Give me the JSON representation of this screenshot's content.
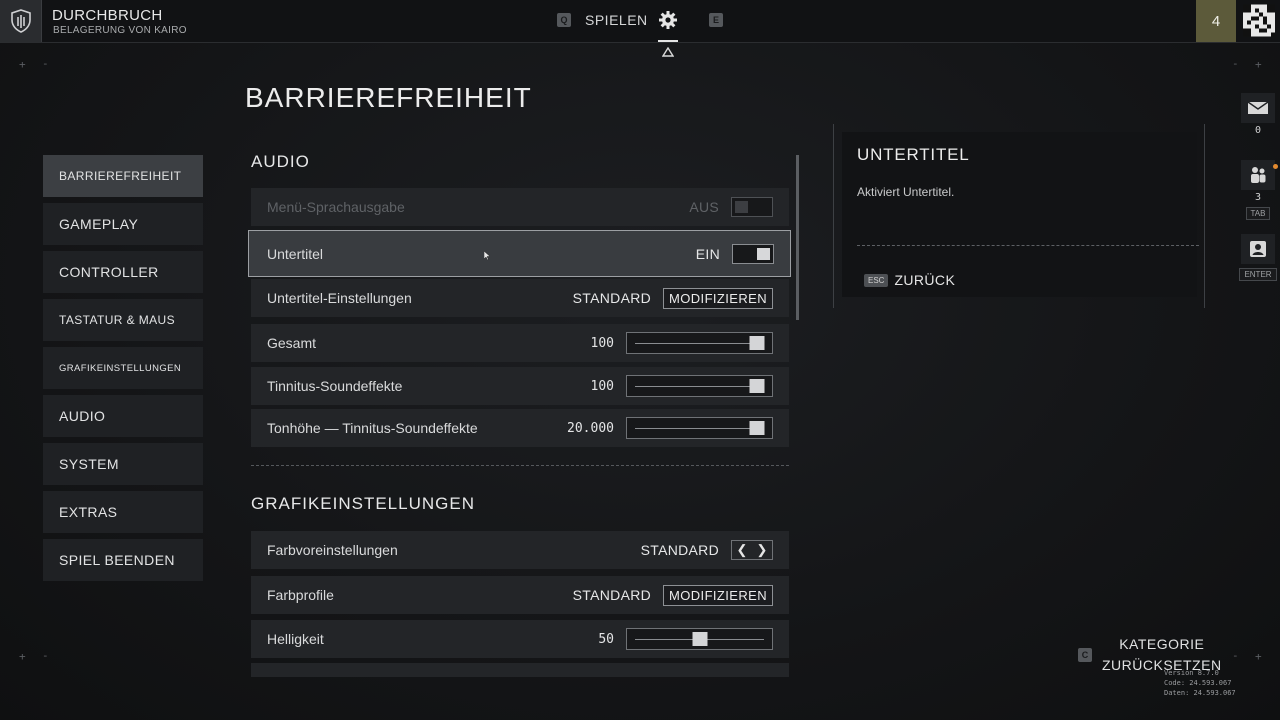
{
  "topbar": {
    "mode_title": "DURCHBRUCH",
    "mode_subtitle": "BELAGERUNG VON KAIRO",
    "nav_left_key": "Q",
    "nav_play": "SPIELEN",
    "nav_right_key": "E",
    "level": "4",
    "icons": {
      "mode": "shield-icon",
      "settings": "gear-icon",
      "profile": "qr-code-icon"
    }
  },
  "page": {
    "title": "BARRIEREFREIHEIT"
  },
  "menu": {
    "items": [
      {
        "label": "BARRIEREFREIHEIT",
        "active": true
      },
      {
        "label": "GAMEPLAY"
      },
      {
        "label": "CONTROLLER"
      },
      {
        "label": "TASTATUR & MAUS"
      },
      {
        "label": "GRAFIKEINSTELLUNGEN"
      },
      {
        "label": "AUDIO"
      },
      {
        "label": "SYSTEM"
      },
      {
        "label": "EXTRAS"
      },
      {
        "label": "SPIEL BEENDEN"
      }
    ]
  },
  "audio": {
    "heading": "AUDIO",
    "rows": [
      {
        "label": "Menü-Sprachausgabe",
        "value": "AUS",
        "control": "toggle",
        "state": "off",
        "disabled": true
      },
      {
        "label": "Untertitel",
        "value": "EIN",
        "control": "toggle",
        "state": "on",
        "selected": true
      },
      {
        "label": "Untertitel-Einstellungen",
        "value": "STANDARD",
        "control": "button",
        "button_label": "MODIFIZIEREN"
      },
      {
        "label": "Gesamt",
        "value": "100",
        "control": "slider",
        "fraction": 1.0
      },
      {
        "label": "Tinnitus-Soundeffekte",
        "value": "100",
        "control": "slider",
        "fraction": 1.0
      },
      {
        "label": "Tonhöhe — Tinnitus-Soundeffekte",
        "value": "20.000",
        "control": "slider",
        "fraction": 1.0
      }
    ]
  },
  "graphics": {
    "heading": "GRAFIKEINSTELLUNGEN",
    "rows": [
      {
        "label": "Farbvoreinstellungen",
        "value": "STANDARD",
        "control": "stepper"
      },
      {
        "label": "Farbprofile",
        "value": "STANDARD",
        "control": "button",
        "button_label": "MODIFIZIEREN"
      },
      {
        "label": "Helligkeit",
        "value": "50",
        "control": "slider",
        "fraction": 0.5
      }
    ]
  },
  "detail": {
    "title": "UNTERTITEL",
    "description": "Aktiviert Untertitel.",
    "back_key": "ESC",
    "back_label": "ZURÜCK"
  },
  "rail": {
    "mail_count": "0",
    "party_count": "3",
    "party_key": "TAB",
    "profile_key": "ENTER"
  },
  "reset": {
    "key": "C",
    "line1": "KATEGORIE",
    "line2": "ZURÜCKSETZEN"
  },
  "version": {
    "line1": "Version 8.7.0",
    "line2": "Code: 24.593.067",
    "line3": "Daten: 24.593.067"
  },
  "colors": {
    "background": "#141517",
    "row": "#232528",
    "selected_row": "#393c40",
    "accent_badge": "#5c5a3a",
    "notify": "#e38a2f"
  }
}
